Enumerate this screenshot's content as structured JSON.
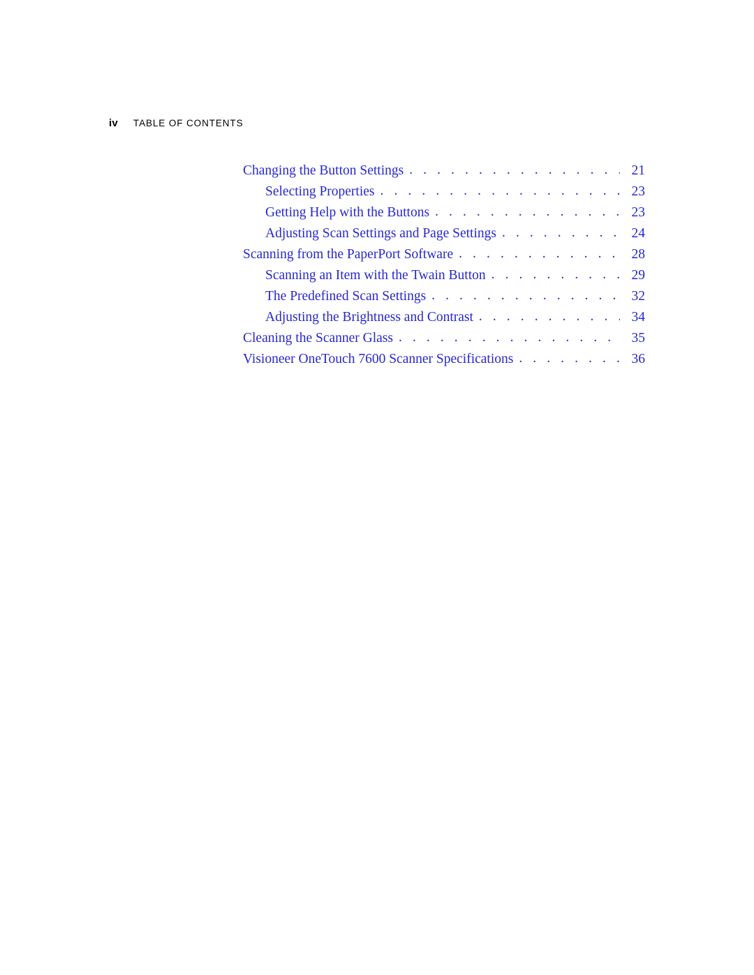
{
  "header": {
    "folio": "iv",
    "title": "Table of Contents"
  },
  "colors": {
    "toc_text": "#2727cf",
    "header_text": "#000000",
    "page_background": "#ffffff"
  },
  "toc": {
    "entries": [
      {
        "title": "Changing the Button Settings",
        "page": "21",
        "level": 1
      },
      {
        "title": "Selecting Properties",
        "page": "23",
        "level": 2
      },
      {
        "title": "Getting Help with the Buttons",
        "page": "23",
        "level": 2
      },
      {
        "title": "Adjusting Scan Settings and Page Settings",
        "page": "24",
        "level": 2
      },
      {
        "title": "Scanning from the PaperPort Software",
        "page": "28",
        "level": 1
      },
      {
        "title": "Scanning an Item with the Twain Button",
        "page": "29",
        "level": 2
      },
      {
        "title": "The Predefined Scan Settings",
        "page": "32",
        "level": 2
      },
      {
        "title": "Adjusting the Brightness and Contrast",
        "page": "34",
        "level": 2
      },
      {
        "title": "Cleaning the Scanner Glass",
        "page": "35",
        "level": 1
      },
      {
        "title": "Visioneer OneTouch 7600 Scanner Specifications",
        "page": "36",
        "level": 1
      }
    ],
    "leader": ". . . . . . . . . . . . . . . . . . . . . . . . . . . . . . . . . . . . . . . . . . . . . . . . . . . . . . . . . . . ."
  }
}
